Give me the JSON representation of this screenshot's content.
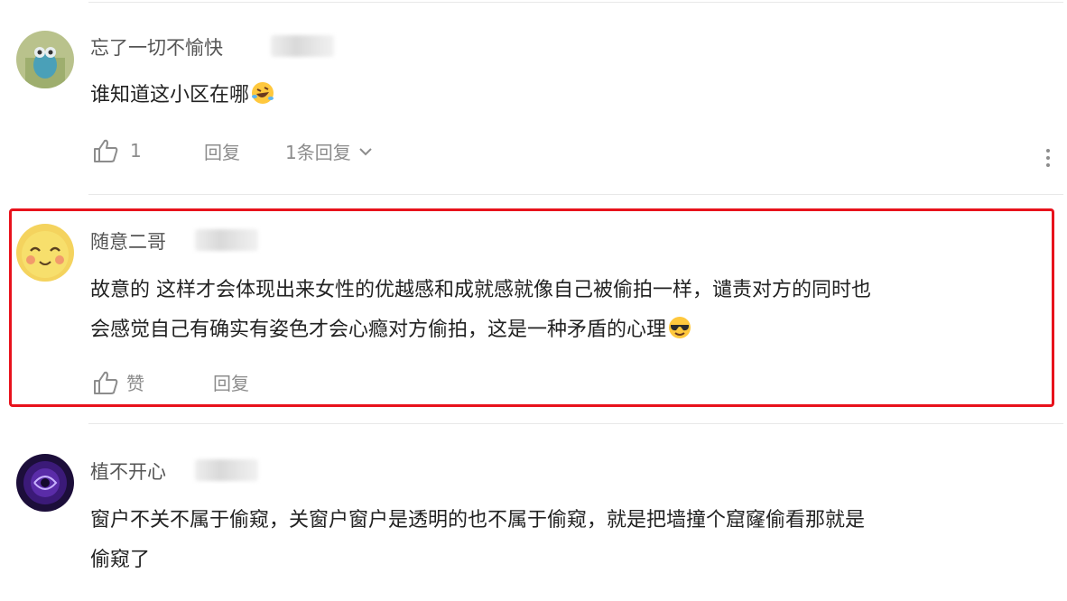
{
  "comments": [
    {
      "username": "忘了一切不愉快",
      "text": "谁知道这小区在哪",
      "emoji": "rofl-emoji",
      "like_label": "1",
      "reply_label": "回复",
      "replies_label": "1条回复"
    },
    {
      "username": "随意二哥",
      "text_line1": "故意的 这样才会体现出来女性的优越感和成就感就像自己被偷拍一样，谴责对方的同时也",
      "text_line2": "会感觉自己有确实有姿色才会心瘾对方偷拍，这是一种矛盾的心理",
      "emoji": "sunglasses-emoji",
      "like_label": "赞",
      "reply_label": "回复",
      "highlighted": true
    },
    {
      "username": "植不开心",
      "text_line1": "窗户不关不属于偷窥，关窗户窗户是透明的也不属于偷窥，就是把墙撞个窟窿偷看那就是",
      "text_line2": "偷窥了"
    }
  ],
  "colors": {
    "highlight": "#e8121c",
    "text": "#222222",
    "muted": "#8c8c8c"
  }
}
